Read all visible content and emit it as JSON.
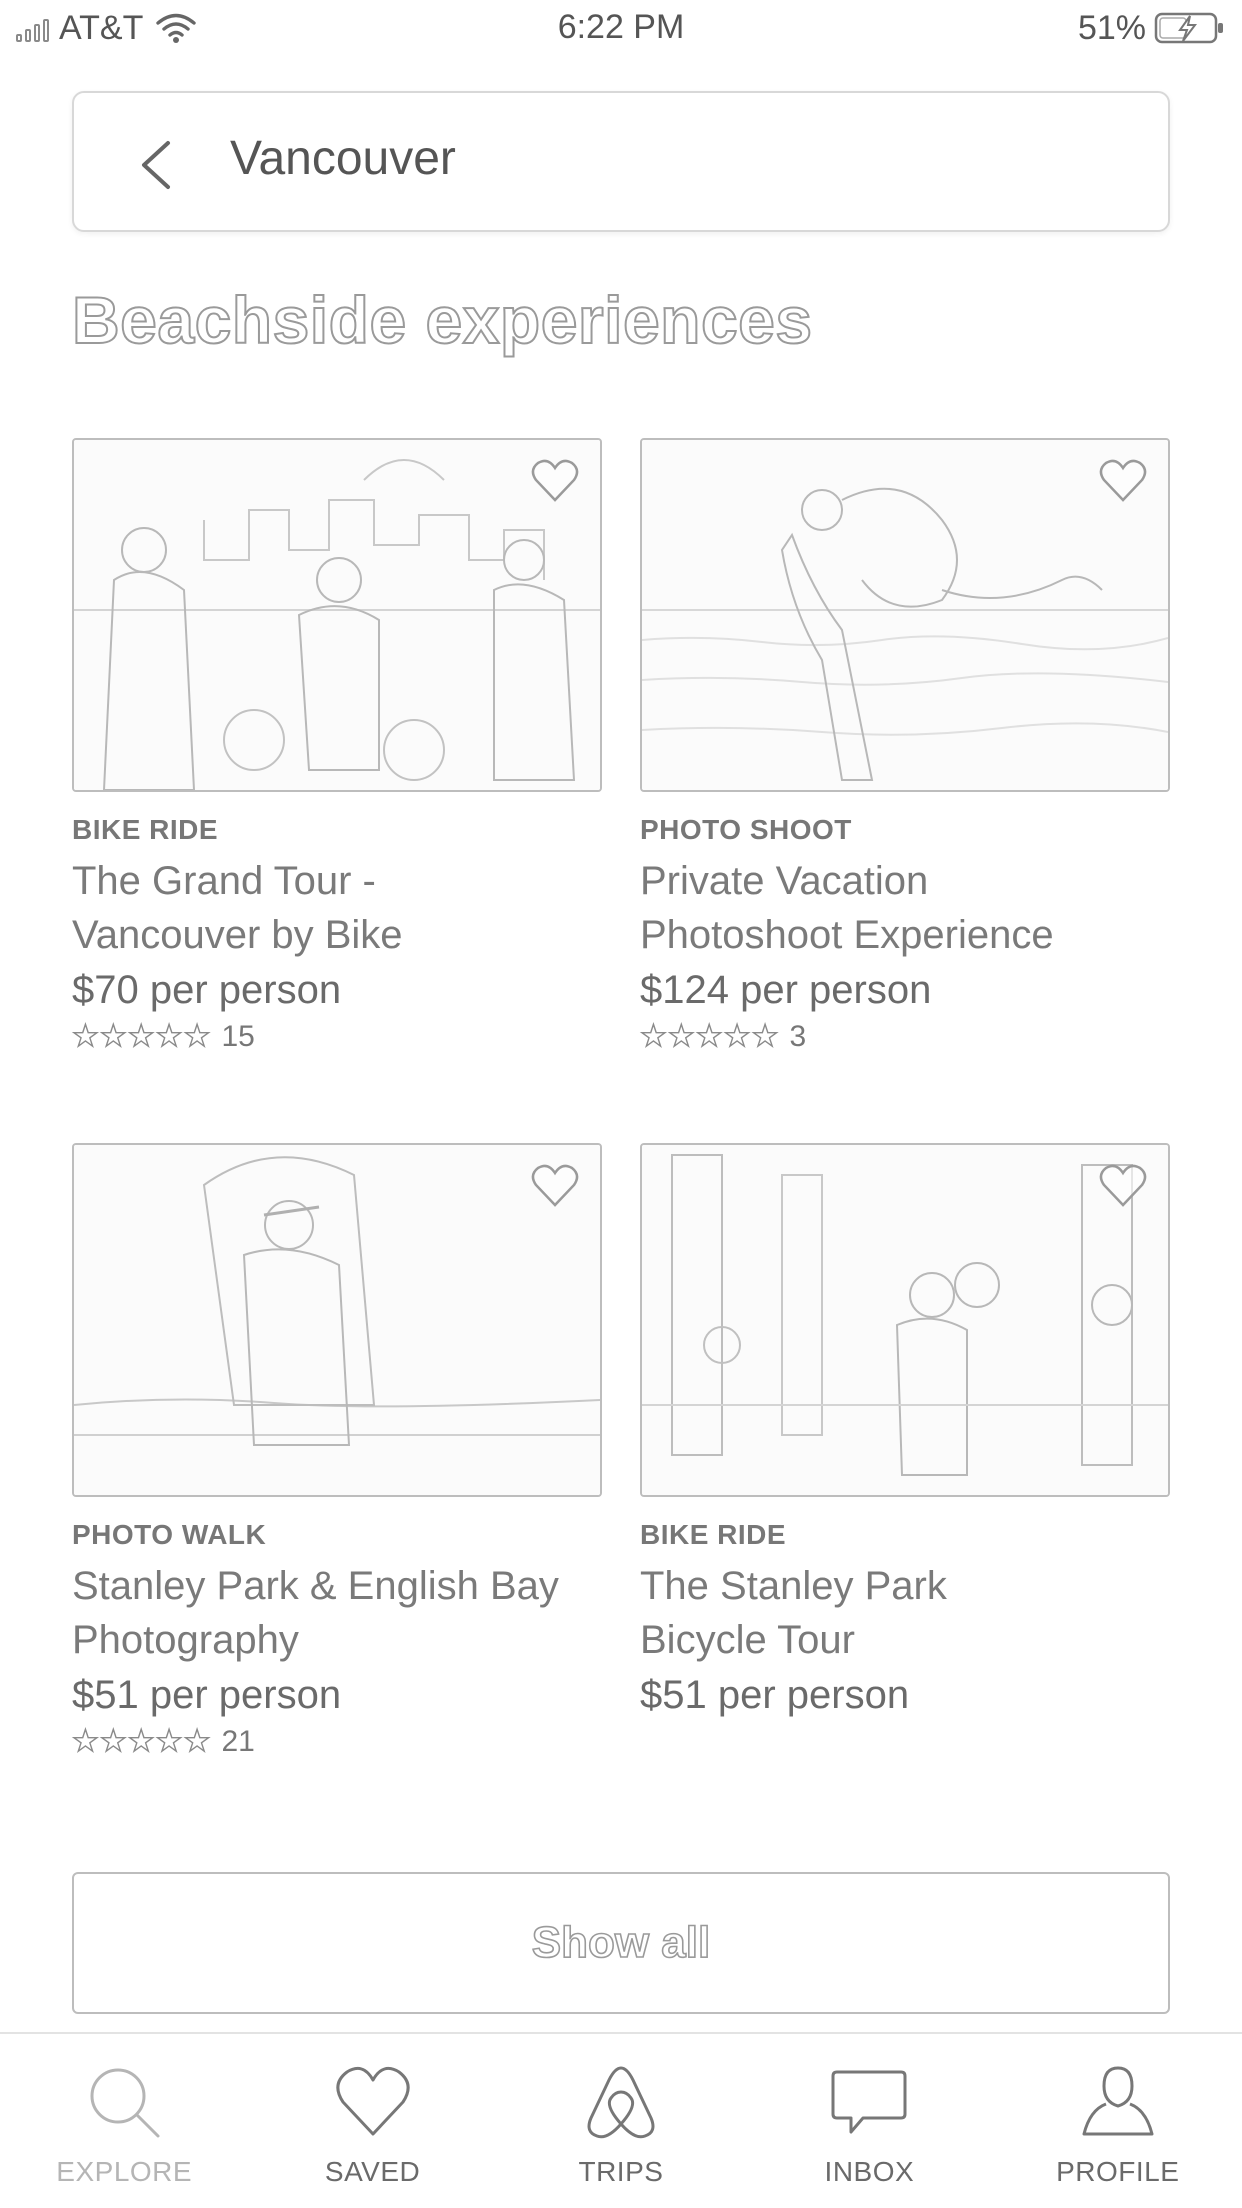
{
  "status_bar": {
    "carrier": "AT&T",
    "time": "6:22 PM",
    "battery": "51%"
  },
  "search": {
    "value": "Vancouver"
  },
  "section": {
    "title": "Beachside experiences"
  },
  "cards": [
    {
      "category": "BIKE RIDE",
      "title_line1": "The Grand Tour -",
      "title_line2": "Vancouver by Bike",
      "price": "$70 per person",
      "stars": "★★★★★",
      "review_count": "15"
    },
    {
      "category": "PHOTO SHOOT",
      "title_line1": "Private Vacation",
      "title_line2": "Photoshoot Experience",
      "price": "$124 per person",
      "stars": "★★★★★",
      "review_count": "3"
    },
    {
      "category": "PHOTO WALK",
      "title_line1": "Stanley Park & English Bay",
      "title_line2": "Photography",
      "price": "$51 per person",
      "stars": "★★★★★",
      "review_count": "21"
    },
    {
      "category": "BIKE RIDE",
      "title_line1": "The Stanley Park",
      "title_line2": "Bicycle Tour",
      "price": "$51 per person"
    }
  ],
  "show_all": {
    "label": "Show all"
  },
  "tab_bar": {
    "tabs": [
      {
        "label": "EXPLORE",
        "icon": "search-icon"
      },
      {
        "label": "SAVED",
        "icon": "heart-icon"
      },
      {
        "label": "TRIPS",
        "icon": "airbnb-logo-icon"
      },
      {
        "label": "INBOX",
        "icon": "chat-bubble-icon"
      },
      {
        "label": "PROFILE",
        "icon": "person-icon"
      }
    ]
  }
}
